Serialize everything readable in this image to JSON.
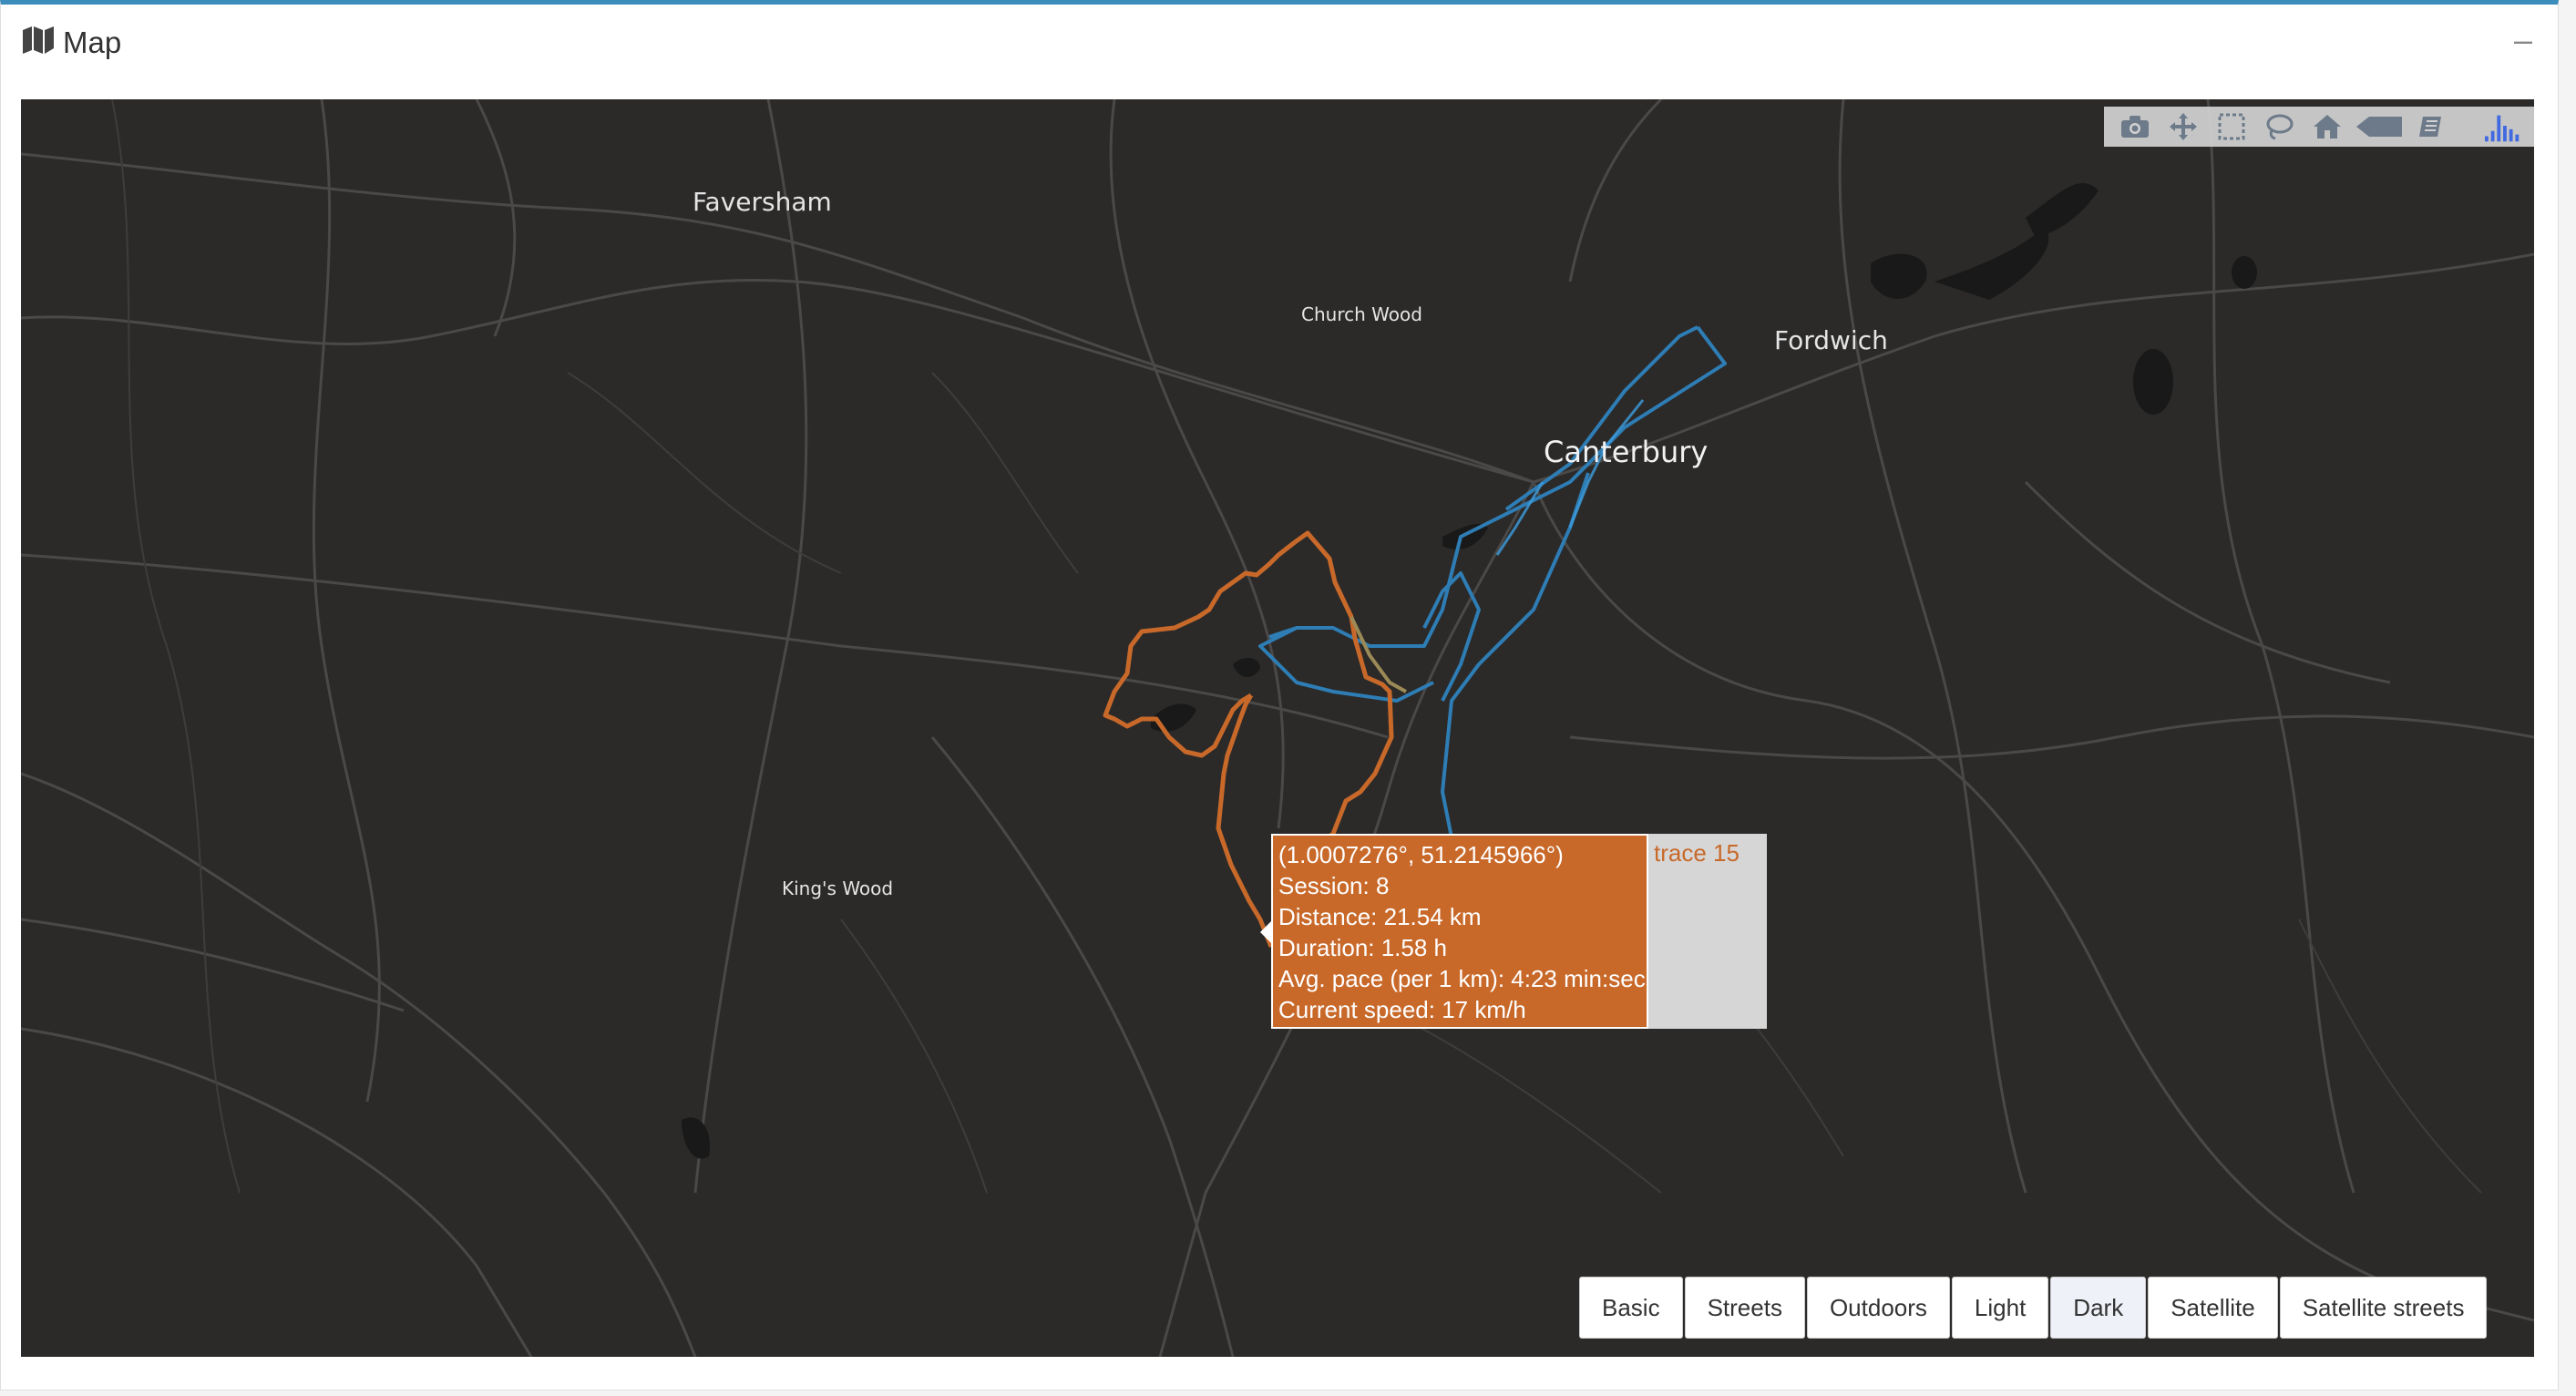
{
  "header": {
    "title": "Map",
    "collapse_symbol": "–"
  },
  "icons": {
    "title": "map-icon"
  },
  "modebar": [
    {
      "name": "camera-icon"
    },
    {
      "name": "pan-icon"
    },
    {
      "name": "box-select-icon"
    },
    {
      "name": "lasso-icon"
    },
    {
      "name": "home-icon"
    },
    {
      "name": "toggle-spike-icon"
    },
    {
      "name": "mapbox-icon"
    },
    {
      "name": "plotly-logo-icon"
    }
  ],
  "places": {
    "faversham": "Faversham",
    "church_wood": "Church Wood",
    "fordwich": "Fordwich",
    "canterbury": "Canterbury",
    "kings_wood": "King's Wood"
  },
  "tooltip": {
    "coords": "(1.0007276°, 51.2145966°)",
    "session": "Session: 8",
    "distance": "Distance: 21.54 km",
    "duration": "Duration: 1.58 h",
    "pace": "Avg. pace (per 1 km): 4:23 min:sec",
    "speed": "Current speed: 17 km/h",
    "trace": "trace 15"
  },
  "map_styles": {
    "basic": "Basic",
    "streets": "Streets",
    "outdoors": "Outdoors",
    "light": "Light",
    "dark": "Dark",
    "satellite": "Satellite",
    "satellite_streets": "Satellite streets",
    "selected": "Dark"
  },
  "colors": {
    "accent": "#3c8dbc",
    "map_bg": "#2b2a29",
    "orange_trace": "#c8692a",
    "blue_trace": "#2e7db5"
  }
}
